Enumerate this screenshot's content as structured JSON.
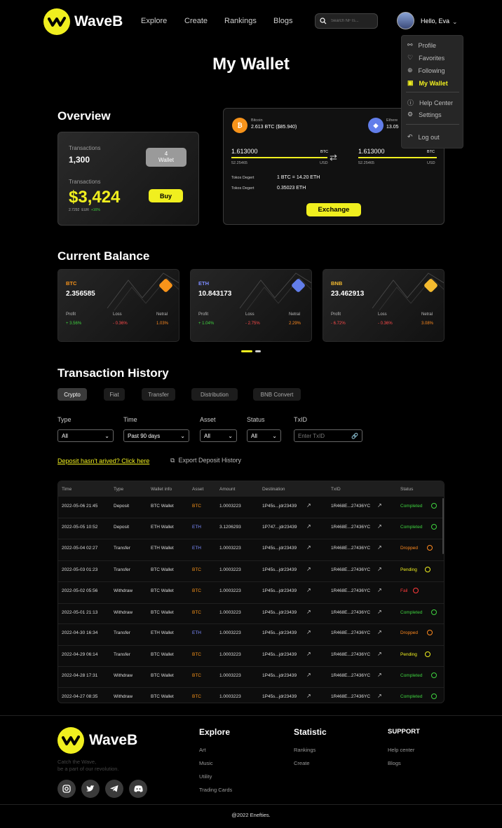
{
  "header": {
    "brand": "WaveB",
    "nav": [
      "Explore",
      "Create",
      "Rankings",
      "Blogs"
    ],
    "search_placeholder": "Search NFTs...",
    "greeting": "Hello, Eva"
  },
  "menu": {
    "items": [
      "Profile",
      "Favorites",
      "Following",
      "My Wallet",
      "Help Center",
      "Settings",
      "Log out"
    ],
    "active": "My Wallet"
  },
  "page_title": "My Wallet",
  "overview": {
    "title": "Overview",
    "tx_label1": "Transactions",
    "tx_value": "1,300",
    "wallet_btn_num": "4",
    "wallet_btn_label": "Wallet",
    "tx_label2": "Transactions",
    "amount": "$3,424",
    "sub_eur": "2.7292",
    "sub_cur": "EUR",
    "sub_pct": "+16%",
    "buy": "Buy"
  },
  "exchange": {
    "from_name": "Bitcoin",
    "from_amount": "2.613 BTC ($85.940)",
    "to_name": "Ethere",
    "to_amount": "13.05",
    "from_val": "1.613000",
    "from_unit": "BTC",
    "from_usd": "52.25465",
    "from_usd_unit": "USD",
    "to_val": "1.613000",
    "to_unit": "BTC",
    "to_usd": "52.25465",
    "to_usd_unit": "USD",
    "rate_label1": "Tokos Degert",
    "rate_val1": "1 BTC = 14.20 ETH",
    "rate_label2": "Tokos Degert",
    "rate_val2": "0.35023 ETH",
    "btn": "Exchange"
  },
  "balance": {
    "title": "Current Balance",
    "cards": [
      {
        "sym": "BTC",
        "value": "2.356585",
        "profit": "+ 3.56%",
        "loss": "- 0.36%",
        "netral": "1.03%",
        "color": "#f7931a",
        "sym_color": "#f7931a"
      },
      {
        "sym": "ETH",
        "value": "10.843173",
        "profit": "+ 1.04%",
        "loss": "- 2.75%",
        "netral": "2.29%",
        "color": "#627eea",
        "sym_color": "#7c8cff"
      },
      {
        "sym": "BNB",
        "value": "23.462913",
        "profit": "- 6.72%",
        "loss": "- 0.36%",
        "netral": "3.08%",
        "color": "#f3ba2f",
        "sym_color": "#f3ba2f"
      }
    ],
    "labels": {
      "profit": "Profit",
      "loss": "Loss",
      "netral": "Netral"
    }
  },
  "history": {
    "title": "Transaction History",
    "tabs": [
      "Crypto",
      "Fiat",
      "Transfer",
      "Distribution",
      "BNB Convert"
    ],
    "filters": {
      "type_label": "Type",
      "type_val": "All",
      "time_label": "Time",
      "time_val": "Past 90 days",
      "asset_label": "Asset",
      "asset_val": "All",
      "status_label": "Status",
      "status_val": "All",
      "txid_label": "TxID",
      "txid_placeholder": "Enter TxID"
    },
    "deposit_link": "Deposit hasn't arived? Click here",
    "export": "Export Deposit History",
    "columns": [
      "Time",
      "Type",
      "Wallet info",
      "Asset",
      "Amount",
      "Destination",
      "TxID",
      "Status"
    ],
    "rows": [
      [
        "2022-05-06 21:45",
        "Deposit",
        "BTC Wallet",
        "BTC",
        "1.0003223",
        "1P45s...jdr23439",
        "1R468E...27436YC",
        "Completed"
      ],
      [
        "2022-05-05 10:52",
        "Deposit",
        "ETH Wallet",
        "ETH",
        "3.1206293",
        "1P747...jdr23439",
        "1R468E...27436YC",
        "Completed"
      ],
      [
        "2022-05-04 02:27",
        "Transfer",
        "ETH Wallet",
        "ETH",
        "1.0003223",
        "1P45s...jdr23439",
        "1R468E...27436YC",
        "Dropped"
      ],
      [
        "2022-05-03 01:23",
        "Transfer",
        "BTC Wallet",
        "BTC",
        "1.0003223",
        "1P45s...jdr23439",
        "1R468E...27436YC",
        "Pending"
      ],
      [
        "2022-05-02 05:56",
        "Withdraw",
        "BTC Wallet",
        "BTC",
        "1.0003223",
        "1P45s...jdr23439",
        "1R468E...27436YC",
        "Fail"
      ],
      [
        "2022-05-01 21:13",
        "Withdraw",
        "BTC Wallet",
        "BTC",
        "1.0003223",
        "1P45s...jdr23439",
        "1R468E...27436YC",
        "Completed"
      ],
      [
        "2022-04-30 16:34",
        "Transfer",
        "ETH Wallet",
        "ETH",
        "1.0003223",
        "1P45s...jdr23439",
        "1R468E...27436YC",
        "Dropped"
      ],
      [
        "2022-04-29 06:14",
        "Transfer",
        "BTC Wallet",
        "BTC",
        "1.0003223",
        "1P45s...jdr23439",
        "1R468E...27436YC",
        "Pending"
      ],
      [
        "2022-04-28 17:31",
        "Withdraw",
        "BTC Wallet",
        "BTC",
        "1.0003223",
        "1P45s...jdr23439",
        "1R468E...27436YC",
        "Completed"
      ],
      [
        "2022-04-27 08:35",
        "Withdraw",
        "BTC Wallet",
        "BTC",
        "1.0003223",
        "1P45s...jdr23439",
        "1R468E...27436YC",
        "Completed"
      ]
    ],
    "status_colors": {
      "Completed": "#3fd33f",
      "Dropped": "#ff8a1f",
      "Pending": "#f0ef1f",
      "Fail": "#ff3b3b"
    },
    "asset_colors": {
      "BTC": "#f7931a",
      "ETH": "#7c8cff"
    }
  },
  "footer": {
    "brand": "WaveB",
    "tagline1": "Catch the Wave,",
    "tagline2": "be a part of our revolution.",
    "explore_title": "Explore",
    "explore_links": [
      "Art",
      "Music",
      "Utility",
      "Trading Cards"
    ],
    "stat_title": "Statistic",
    "stat_links": [
      "Rankings",
      "Create"
    ],
    "support_title": "SUPPORT",
    "support_links": [
      "Help center",
      "Blogs"
    ],
    "copyright": "@2022 Enefties."
  }
}
